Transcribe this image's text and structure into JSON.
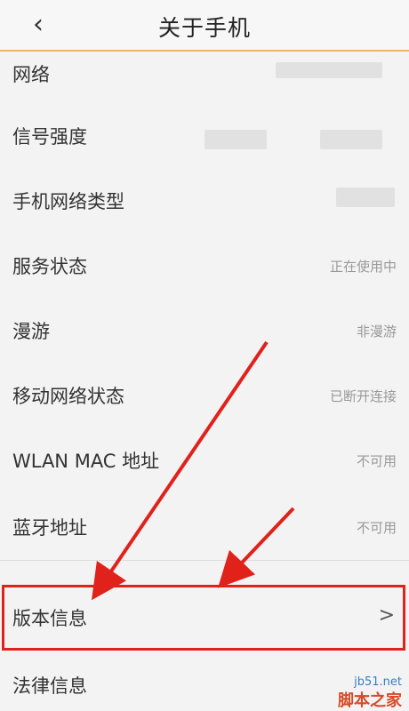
{
  "header": {
    "title": "关于手机",
    "back_icon": "chevron-left-icon"
  },
  "rows": [
    {
      "label": "网络",
      "value": ""
    },
    {
      "label": "信号强度",
      "value": ""
    },
    {
      "label": "手机网络类型",
      "value": ""
    },
    {
      "label": "服务状态",
      "value": "正在使用中"
    },
    {
      "label": "漫游",
      "value": "非漫游"
    },
    {
      "label": "移动网络状态",
      "value": "已断开连接"
    },
    {
      "label": "WLAN MAC 地址",
      "value": "不可用"
    },
    {
      "label": "蓝牙地址",
      "value": "不可用"
    },
    {
      "label": "版本信息",
      "value": ">"
    },
    {
      "label": "法律信息",
      "value": ""
    }
  ],
  "watermark": {
    "line1": "jb51.net",
    "line2": "脚本之家"
  },
  "colors": {
    "highlight": "#e0221b",
    "header_border": "#f0b25a"
  }
}
